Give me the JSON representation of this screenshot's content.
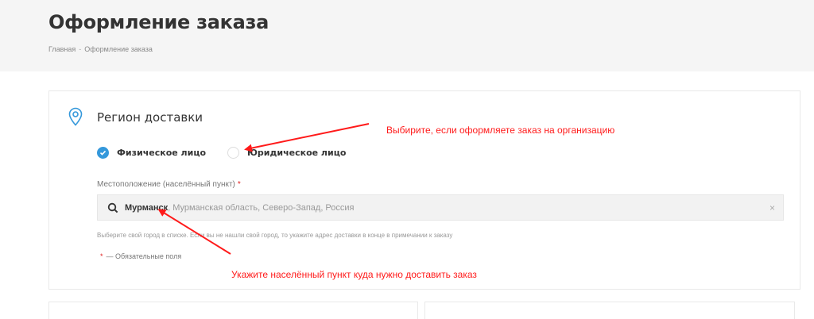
{
  "header": {
    "title": "Оформление заказа",
    "breadcrumb": [
      "Главная",
      "Оформление заказа"
    ],
    "breadcrumb_sep": "-"
  },
  "region": {
    "title": "Регион доставки",
    "icon": "map-pin-icon",
    "person_types": [
      {
        "label": "Физическое лицо",
        "checked": true
      },
      {
        "label": "Юридическое лицо",
        "checked": false
      }
    ],
    "location_label": "Местоположение (населённый пункт)",
    "required_star": "*",
    "location_city": "Мурманск",
    "location_rest": ", Мурманская область, Северо-Запад, Россия",
    "clear": "×",
    "hint": "Выберите свой город в списке. Если вы не нашли свой город, то укажите адрес доставки в конце в примечании к заказу",
    "required_note": "— Обязательные поля"
  },
  "annotations": {
    "org": "Выбирите, если оформляете заказ на организацию",
    "city": "Укажите населённый пункт куда нужно доставить заказ"
  },
  "colors": {
    "accent": "#3498db",
    "annotation": "#ff1a1a",
    "required": "#e02020"
  }
}
